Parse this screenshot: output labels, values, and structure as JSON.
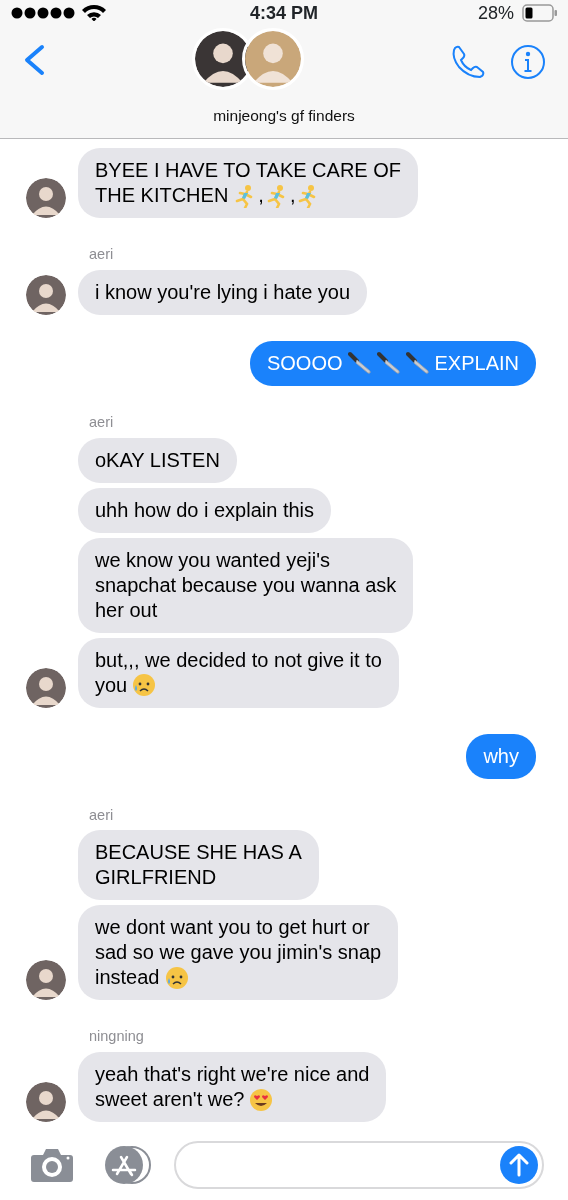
{
  "status_bar": {
    "time": "4:34 PM",
    "battery": "28%"
  },
  "header": {
    "title": "minjeong's gf finders"
  },
  "messages": [
    {
      "from_me": false,
      "avatar": true,
      "lines": [
        [
          {
            "kind": "text",
            "text": "BYEE I HAVE TO TAKE CARE OF"
          }
        ],
        [
          {
            "kind": "text",
            "text": "THE KITCHEN"
          },
          {
            "kind": "runner"
          },
          {
            "kind": "text",
            "text": ","
          },
          {
            "kind": "runner"
          },
          {
            "kind": "text",
            "text": ","
          },
          {
            "kind": "runner"
          }
        ]
      ]
    },
    {
      "from_me": false,
      "sender": "aeri",
      "avatar": true,
      "lines": [
        [
          {
            "kind": "text",
            "text": "i know you're lying i hate you"
          }
        ]
      ]
    },
    {
      "from_me": true,
      "lines": [
        [
          {
            "kind": "text",
            "text": "SOOOO"
          },
          {
            "kind": "knife"
          },
          {
            "kind": "knife"
          },
          {
            "kind": "knife"
          },
          {
            "kind": "text",
            "text": "EXPLAIN"
          }
        ]
      ]
    },
    {
      "from_me": false,
      "sender": "aeri",
      "avatar": false,
      "lines": [
        [
          {
            "kind": "text",
            "text": "oKAY LISTEN"
          }
        ]
      ]
    },
    {
      "from_me": false,
      "avatar": false,
      "lines": [
        [
          {
            "kind": "text",
            "text": "uhh how do i explain this"
          }
        ]
      ]
    },
    {
      "from_me": false,
      "avatar": false,
      "lines": [
        [
          {
            "kind": "text",
            "text": "we know you wanted yeji's"
          }
        ],
        [
          {
            "kind": "text",
            "text": "snapchat because you wanna ask"
          }
        ],
        [
          {
            "kind": "text",
            "text": "her out"
          }
        ]
      ]
    },
    {
      "from_me": false,
      "avatar": true,
      "lines": [
        [
          {
            "kind": "text",
            "text": "but,,, we decided to not give it to"
          }
        ],
        [
          {
            "kind": "text",
            "text": "you"
          },
          {
            "kind": "sad"
          }
        ]
      ]
    },
    {
      "from_me": true,
      "lines": [
        [
          {
            "kind": "text",
            "text": "why"
          }
        ]
      ]
    },
    {
      "from_me": false,
      "sender": "aeri",
      "avatar": false,
      "lines": [
        [
          {
            "kind": "text",
            "text": "BECAUSE SHE HAS A"
          }
        ],
        [
          {
            "kind": "text",
            "text": "GIRLFRIEND"
          }
        ]
      ]
    },
    {
      "from_me": false,
      "avatar": true,
      "lines": [
        [
          {
            "kind": "text",
            "text": "we dont want you to get hurt or"
          }
        ],
        [
          {
            "kind": "text",
            "text": "sad so we gave you jimin's snap"
          }
        ],
        [
          {
            "kind": "text",
            "text": "instead"
          },
          {
            "kind": "sad"
          }
        ]
      ]
    },
    {
      "from_me": false,
      "sender": "ningning",
      "avatar": true,
      "lines": [
        [
          {
            "kind": "text",
            "text": "yeah that's right we're nice and"
          }
        ],
        [
          {
            "kind": "text",
            "text": "sweet aren't we?"
          },
          {
            "kind": "heart_eyes"
          }
        ]
      ]
    }
  ]
}
